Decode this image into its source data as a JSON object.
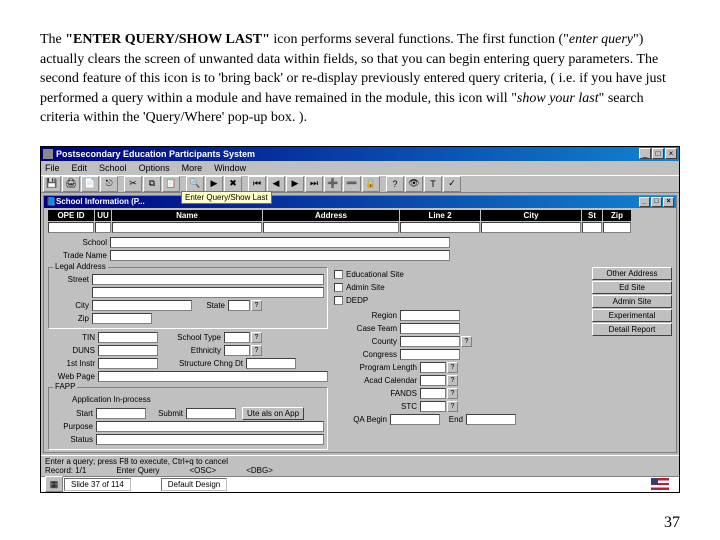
{
  "doc": {
    "paragraph_parts": [
      "The ",
      "\"ENTER QUERY/SHOW LAST\"",
      " icon performs several functions.  The first function (\"",
      "enter query",
      "\") actually clears the screen of unwanted data within fields, so that you can begin entering query parameters.  The second feature of this icon is to 'bring back' or re-display previously entered query criteria, ( i.e. if you have just performed a query within a module and have remained in the module, this icon will \"",
      "show your last",
      "\" search criteria within the 'Query/Where' pop-up box. )."
    ],
    "page_number": "37"
  },
  "app": {
    "title": "Postsecondary Education Participants System",
    "menu": {
      "file": "File",
      "edit": "Edit",
      "school": "School",
      "options": "Options",
      "more": "More",
      "window": "Window"
    },
    "tooltip": "Enter Query/Show Last",
    "subwin_title": "School Information (P...",
    "headers": {
      "ope": "OPE ID",
      "uu": "UU",
      "name": "Name",
      "address": "Address",
      "line2": "Line 2",
      "city": "City",
      "st": "St",
      "zip": "Zip"
    },
    "labels": {
      "school": "School",
      "trade_name": "Trade Name",
      "legal_address": "Legal Address",
      "street": "Street",
      "city": "City",
      "zip": "Zip",
      "state": "State",
      "tin": "TIN",
      "duns": "DUNS",
      "first_instr": "1st Instr",
      "web_page": "Web Page",
      "school_type": "School Type",
      "ethnicity": "Ethnicity",
      "structure_chng": "Structure Chng Dt",
      "fapp": "FAPP",
      "app_inprocess": "Application In-process",
      "start": "Start",
      "submit": "Submit",
      "ute_alson_app": "Ute als on App",
      "purpose": "Purpose",
      "status": "Status",
      "educational_site": "Educational Site",
      "admin_site": "Admin Site",
      "dedp": "DEDP",
      "region": "Region",
      "case_team": "Case Team",
      "county": "County",
      "congress": "Congress",
      "program_length": "Program Length",
      "acad_calendar": "Acad Calendar",
      "fands": "FANDS",
      "stc": "STC",
      "qa_begin": "QA Begin",
      "end": "End"
    },
    "side_buttons": {
      "other_address": "Other Address",
      "ed_site": "Ed Site",
      "admin_site": "Admin Site",
      "experimental": "Experimental",
      "detail_report": "Detail Report"
    },
    "status": {
      "line1": "Enter a query; press F8 to execute, Ctrl+q to cancel",
      "line2": "Record: 1/1",
      "enter_query": "Enter Query",
      "osc": "<OSC>",
      "dbg": "<DBG>"
    },
    "bottom": {
      "slide": "Slide 37 of 114",
      "design": "Default Design"
    }
  }
}
